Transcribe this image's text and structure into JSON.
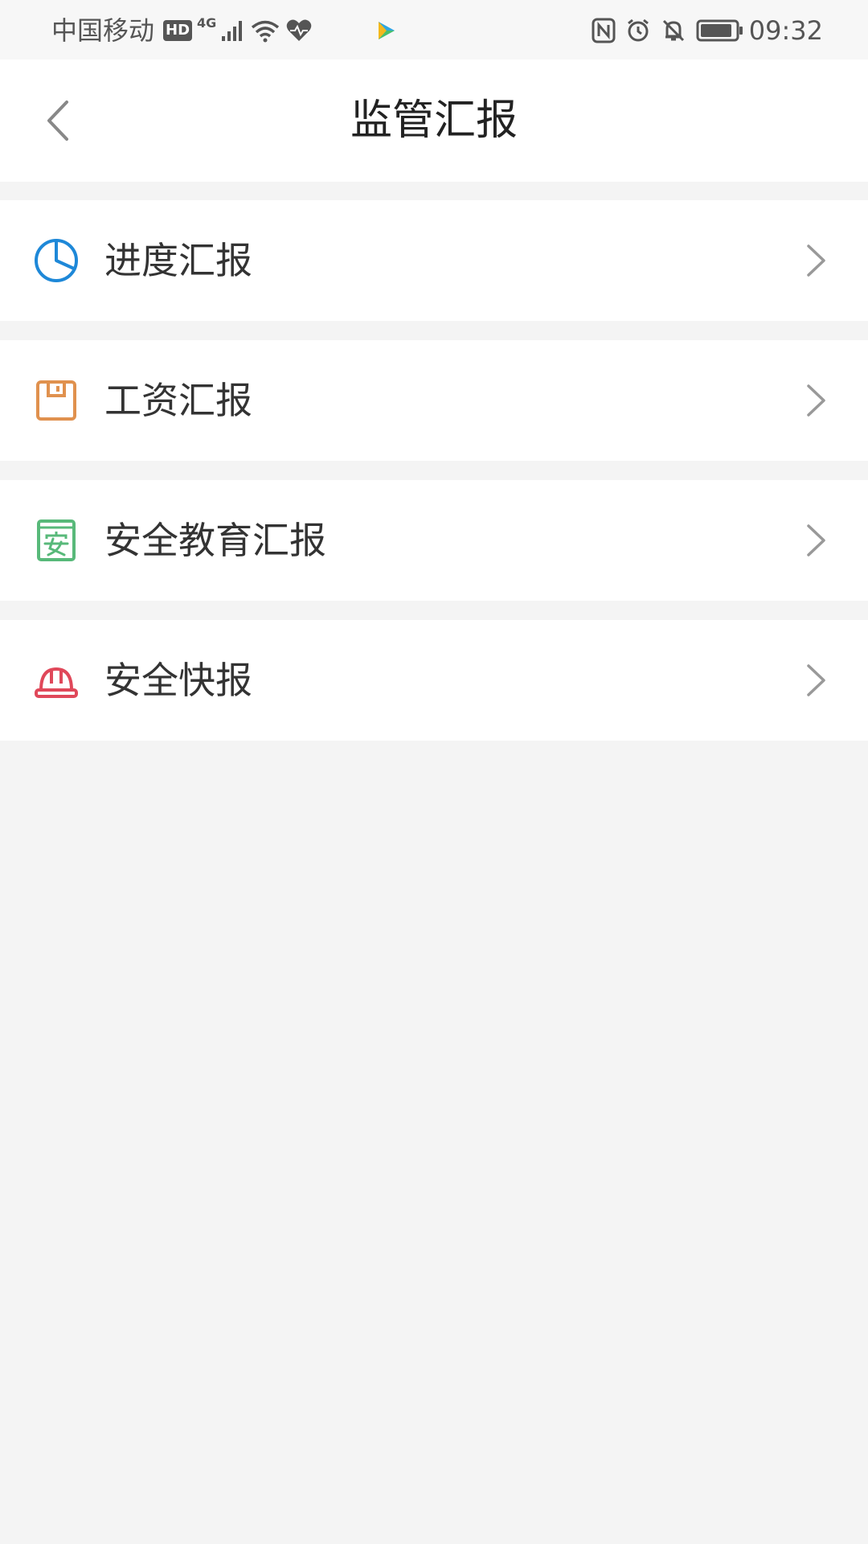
{
  "status_bar": {
    "carrier": "中国移动",
    "hd": "HD",
    "network": "4G",
    "time": "09:32",
    "icons": [
      "hd-icon",
      "signal-icon",
      "wifi-icon",
      "heart-icon",
      "video-app-icon",
      "nfc-icon",
      "alarm-icon",
      "mute-icon",
      "battery-icon"
    ]
  },
  "header": {
    "title": "监管汇报",
    "back_icon": "chevron-left-icon"
  },
  "menu": {
    "items": [
      {
        "label": "进度汇报",
        "icon": "pie-chart-icon",
        "color": "#1e88d8"
      },
      {
        "label": "工资汇报",
        "icon": "save-box-icon",
        "color": "#e0914e"
      },
      {
        "label": "安全教育汇报",
        "icon": "safety-book-icon",
        "color": "#58b97a"
      },
      {
        "label": "安全快报",
        "icon": "hard-hat-icon",
        "color": "#e0485a"
      }
    ],
    "chevron_icon": "chevron-right-icon"
  },
  "colors": {
    "background": "#f4f4f4",
    "surface": "#ffffff",
    "text": "#333333"
  }
}
